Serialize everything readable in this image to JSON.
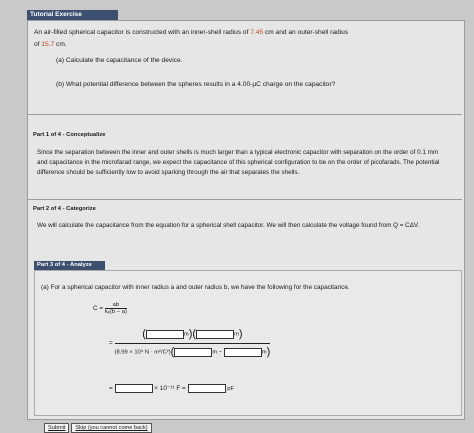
{
  "tab_title": "Tutorial Exercise",
  "problem": {
    "line1_pre": "An air-filled spherical capacitor is constructed with an inner-shell radius of ",
    "inner_radius": "7.45",
    "line1_post": " cm and an outer-shell radius",
    "line2_pre": "of ",
    "outer_radius": "15.7",
    "line2_post": " cm.",
    "part_a": "(a) Calculate the capacitance of the device.",
    "part_b_pre": "(b) What potential difference between the spheres results in a 4.00-µC charge on the capacitor?"
  },
  "part1": {
    "title": "Part 1 of 4 - Conceptualize",
    "body": "Since the separation between the inner and outer shells is much larger than a typical electronic capacitor with separation on the order of 0.1 mm and capacitance in the microfarad range, we expect the capacitance of this spherical configuration to be on the order of picofarads. The potential difference should be sufficiently low to avoid sparking through the air that separates the shells."
  },
  "part2": {
    "title": "Part 2 of 4 - Categorize",
    "body": "We will calculate the capacitance from the equation for a spherical shell capacitor. We will then calculate the voltage found from Q = CΔV."
  },
  "part3": {
    "title": "Part 3 of 4 - Analyze",
    "intro": "(a) For a spherical capacitor with inner radius a and outer radius b, we have the following for the capacitance.",
    "eq1_lhs": "C =",
    "frac_top": "ab",
    "frac_bot": "kₑ(b − a)",
    "equals": "=",
    "unit_m": "m",
    "ke_text": "(8.99 × 10⁹ N · m²/C²)",
    "minus": "−",
    "times": "× 10⁻¹¹ F =",
    "unit_pf": "pF",
    "submit": "Submit",
    "skip": "Skip (you cannot come back)"
  }
}
